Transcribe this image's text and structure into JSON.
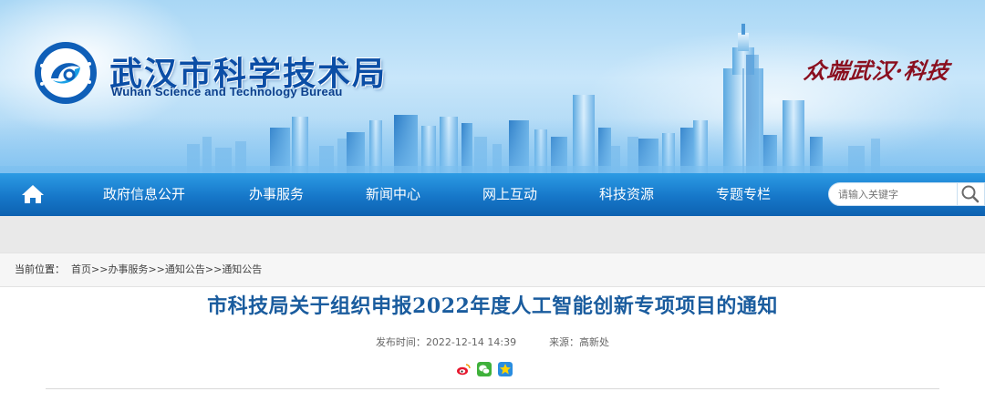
{
  "header": {
    "title_cn": "武汉市科学技术局",
    "title_en": "Wuhan Science and Technology Bureau",
    "slogan": "众端武汉·科技",
    "logo_icon": "bureau-logo-icon"
  },
  "nav": {
    "home_icon": "home-icon",
    "items": [
      {
        "label": "政府信息公开"
      },
      {
        "label": "办事服务"
      },
      {
        "label": "新闻中心"
      },
      {
        "label": "网上互动"
      },
      {
        "label": "科技资源"
      },
      {
        "label": "专题专栏"
      }
    ],
    "search": {
      "placeholder": "请输入关键字",
      "icon": "search-icon"
    }
  },
  "breadcrumb": {
    "label": "当前位置：",
    "items": [
      "首页",
      "办事服务",
      "通知公告",
      "通知公告"
    ],
    "separator": ">>"
  },
  "article": {
    "title": "市科技局关于组织申报2022年度人工智能创新专项项目的通知",
    "published_label": "发布时间：",
    "published_value": "2022-12-14 14:39",
    "source_label": "来源：",
    "source_value": "高新处",
    "share_icons": [
      "weibo-icon",
      "wechat-icon",
      "qzone-icon"
    ]
  },
  "colors": {
    "nav_bg": "#1677c9",
    "title_blue": "#1a5c9e",
    "brand_blue": "#0b4ea6",
    "slogan_red": "#8a0f1f"
  }
}
